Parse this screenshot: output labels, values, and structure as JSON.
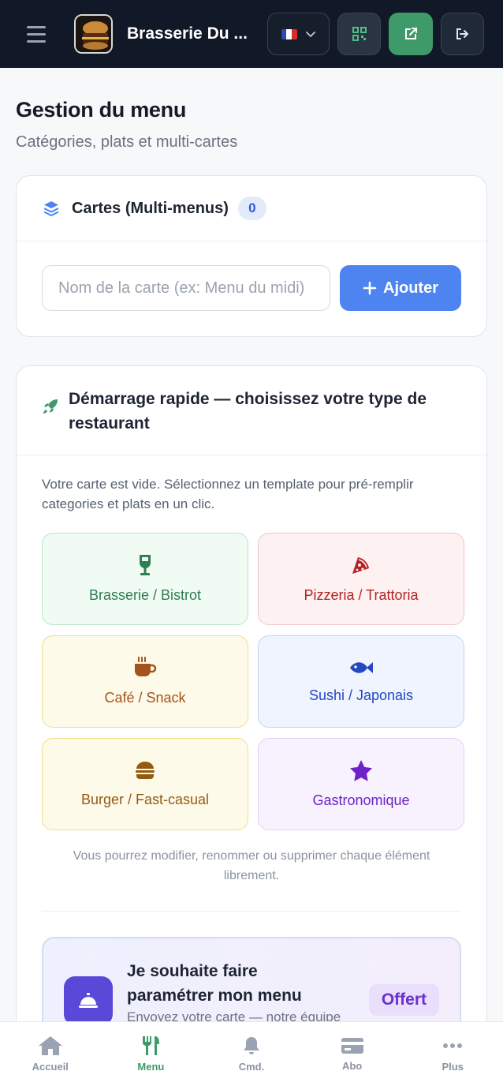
{
  "header": {
    "brand": "Brasserie Du ...",
    "flag": "🇫🇷",
    "colors": {
      "bg": "#111827",
      "accent": "#3f9a6a"
    },
    "icons": [
      "hamburger-icon",
      "chevron-down-icon",
      "qr-code-icon",
      "external-link-icon",
      "logout-icon"
    ]
  },
  "page": {
    "title": "Gestion du menu",
    "subtitle": "Catégories, plats et multi-cartes"
  },
  "menus_card": {
    "title": "Cartes (Multi-menus)",
    "count": "0",
    "input_placeholder": "Nom de la carte (ex: Menu du midi)",
    "add_label": "Ajouter",
    "icon": "layers-icon"
  },
  "quick_start": {
    "title": "Démarrage rapide — choisissez votre type de restaurant",
    "description": "Votre carte est vide. Sélectionnez un template pour pré-remplir categories et plats en un clic.",
    "templates": [
      {
        "label": "Brasserie / Bistrot",
        "icon": "wine-glass-icon",
        "color": "#2f7d52",
        "bg": "#effbf3",
        "border": "#b9e6c8"
      },
      {
        "label": "Pizzeria / Trattoria",
        "icon": "pizza-icon",
        "color": "#b42323",
        "bg": "#fdf1f1",
        "border": "#f2c6c6"
      },
      {
        "label": "Café / Snack",
        "icon": "coffee-icon",
        "color": "#a4541a",
        "bg": "#fefaea",
        "border": "#f4dc8a"
      },
      {
        "label": "Sushi / Japonais",
        "icon": "fish-icon",
        "color": "#2547c2",
        "bg": "#eff4fe",
        "border": "#c3d4f4"
      },
      {
        "label": "Burger / Fast-casual",
        "icon": "burger-icon",
        "color": "#935b12",
        "bg": "#fefaea",
        "border": "#f4dc8a"
      },
      {
        "label": "Gastronomique",
        "icon": "star-icon",
        "color": "#6f22c9",
        "bg": "#f8f2fe",
        "border": "#e1d1f6"
      }
    ],
    "note": "Vous pourrez modifier, renommer ou supprimer chaque élément librement."
  },
  "offer": {
    "title": "Je souhaite faire paramétrer mon menu",
    "subtitle": "Envoyez votre carte — notre équipe",
    "badge": "Offert",
    "icon": "service-bell-icon"
  },
  "bottom_nav": {
    "items": [
      {
        "label": "Accueil",
        "icon": "home-icon"
      },
      {
        "label": "Menu",
        "icon": "utensils-icon",
        "active": true
      },
      {
        "label": "Cmd.",
        "icon": "bell-icon"
      },
      {
        "label": "Abo",
        "icon": "credit-card-icon"
      },
      {
        "label": "Plus",
        "icon": "more-dots-icon"
      }
    ]
  }
}
